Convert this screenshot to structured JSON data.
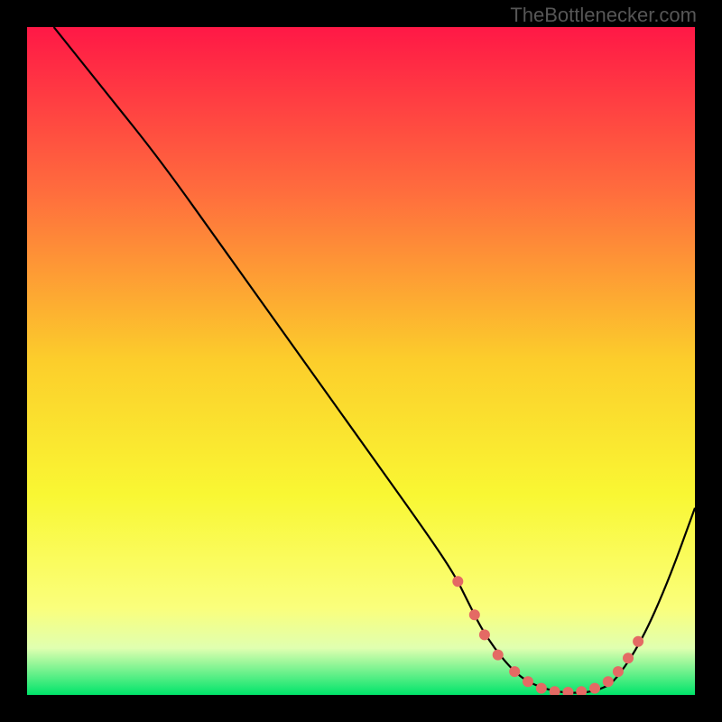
{
  "watermark": "TheBottlenecker.com",
  "chart_data": {
    "type": "line",
    "title": "",
    "xlabel": "",
    "ylabel": "",
    "xlim": [
      0,
      100
    ],
    "ylim": [
      0,
      100
    ],
    "gradient_stops": [
      {
        "offset": 0,
        "color": "#ff1846"
      },
      {
        "offset": 25,
        "color": "#ff6e3d"
      },
      {
        "offset": 50,
        "color": "#fcce2b"
      },
      {
        "offset": 70,
        "color": "#f9f733"
      },
      {
        "offset": 87,
        "color": "#faff7c"
      },
      {
        "offset": 93,
        "color": "#e0ffb0"
      },
      {
        "offset": 100,
        "color": "#00e46a"
      }
    ],
    "series": [
      {
        "name": "bottleneck-curve",
        "x": [
          4,
          12,
          20,
          30,
          40,
          50,
          60,
          64,
          66,
          68,
          70,
          72,
          74,
          76,
          78,
          80,
          82,
          84,
          86,
          88,
          92,
          96,
          100
        ],
        "values": [
          100,
          90,
          80,
          66,
          52,
          38,
          24,
          18,
          14,
          10,
          7,
          4.5,
          2.6,
          1.5,
          0.8,
          0.4,
          0.3,
          0.4,
          0.9,
          2.0,
          8.0,
          17,
          28
        ]
      }
    ],
    "markers": {
      "name": "highlighted-points",
      "color": "#e46a64",
      "points": [
        {
          "x": 64.5,
          "y": 17
        },
        {
          "x": 67,
          "y": 12
        },
        {
          "x": 68.5,
          "y": 9
        },
        {
          "x": 70.5,
          "y": 6
        },
        {
          "x": 73,
          "y": 3.5
        },
        {
          "x": 75,
          "y": 2
        },
        {
          "x": 77,
          "y": 1
        },
        {
          "x": 79,
          "y": 0.5
        },
        {
          "x": 81,
          "y": 0.4
        },
        {
          "x": 83,
          "y": 0.5
        },
        {
          "x": 85,
          "y": 1
        },
        {
          "x": 87,
          "y": 2
        },
        {
          "x": 88.5,
          "y": 3.5
        },
        {
          "x": 90,
          "y": 5.5
        },
        {
          "x": 91.5,
          "y": 8
        }
      ]
    }
  }
}
